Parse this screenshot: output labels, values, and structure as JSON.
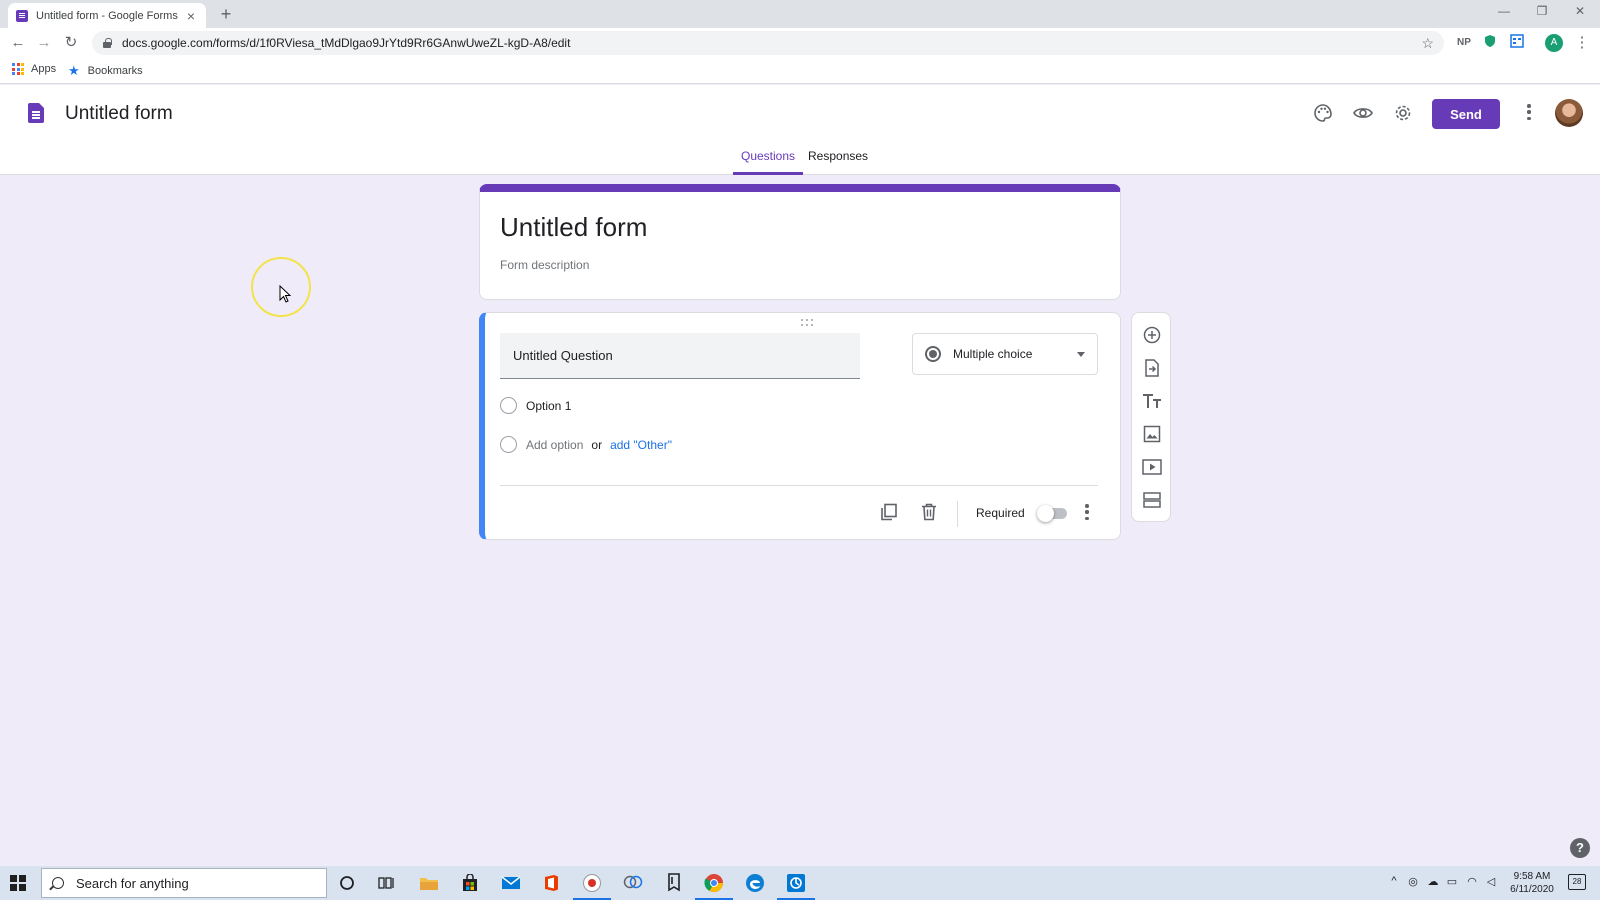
{
  "browser": {
    "tab_title": "Untitled form - Google Forms",
    "url": "docs.google.com/forms/d/1f0RViesa_tMdDlgao9JrYtd9Rr6GAnwUweZL-kgD-A8/edit",
    "bookmarks": [
      {
        "label": "Apps",
        "icon": "apps-grid-icon"
      },
      {
        "label": "Bookmarks",
        "icon": "star-icon"
      }
    ],
    "extensions": [
      "NP"
    ],
    "profile_initial": "A"
  },
  "forms_header": {
    "title": "Untitled form",
    "send_label": "Send",
    "tabs": [
      {
        "label": "Questions",
        "active": true
      },
      {
        "label": "Responses",
        "active": false
      }
    ]
  },
  "form": {
    "title": "Untitled form",
    "description_placeholder": "Form description"
  },
  "question": {
    "title": "Untitled Question",
    "type": "Multiple choice",
    "options": [
      "Option 1"
    ],
    "add_option": "Add option",
    "or": "or",
    "add_other": "add \"Other\"",
    "required_label": "Required",
    "required": false
  },
  "side_toolbar": [
    "add-question-icon",
    "import-questions-icon",
    "add-title-icon",
    "add-image-icon",
    "add-video-icon",
    "add-section-icon"
  ],
  "taskbar": {
    "search_placeholder": "Search for anything",
    "time": "9:58 AM",
    "date": "6/11/2020",
    "notifications": "28"
  },
  "colors": {
    "accent": "#673ab7",
    "question_border": "#4285f4",
    "page_bg": "#f0ebf8"
  }
}
